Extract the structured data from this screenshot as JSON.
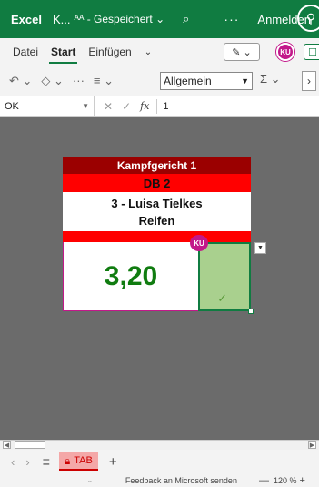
{
  "titlebar": {
    "app_name": "Excel",
    "doc_title": "K...",
    "doc_status": "ᴬᴬ - Gespeichert ⌄",
    "search_icon": "⌕",
    "more": "···",
    "signin": "Anmelden",
    "user_icon": "⚲"
  },
  "ribbon": {
    "tabs": [
      {
        "label": "Datei"
      },
      {
        "label": "Start"
      },
      {
        "label": "Einfügen"
      }
    ],
    "more_chevron": "⌄",
    "pen_label": "✎ ⌄",
    "user_badge": "KU",
    "comment_icon": "☐"
  },
  "toolbar": {
    "undo": "↶ ⌄",
    "fill": "◇ ⌄",
    "more": "···",
    "align": "≡ ⌄",
    "number_format": "Allgemein",
    "sum": "Σ ⌄",
    "next": "›"
  },
  "formula_bar": {
    "name_box": "OK",
    "cancel_icon": "✕",
    "confirm_icon": "✓",
    "fx": "fx",
    "value": "1"
  },
  "sheet": {
    "header": "Kampfgericht 1",
    "subheader": "DB 2",
    "athlete": "3 - Luisa Tielkes",
    "apparatus": "Reifen",
    "score": "3,20",
    "cell_badge": "KU",
    "check_icon": "✓"
  },
  "sheet_tabs": {
    "prev": "‹",
    "next": "›",
    "menu": "≡",
    "active_tab": "TAB",
    "add": "+"
  },
  "status_bar": {
    "caret": "⌄",
    "feedback": "Feedback an Microsoft senden",
    "zoom_out": "—",
    "zoom": "120 %",
    "zoom_in": "+"
  },
  "colors": {
    "brand": "#107c41",
    "header_dark_red": "#9b0000",
    "header_red": "#ff0000",
    "score_green": "#107c10",
    "check_cell_green": "#a9d08e",
    "badge_magenta": "#c2188a"
  }
}
